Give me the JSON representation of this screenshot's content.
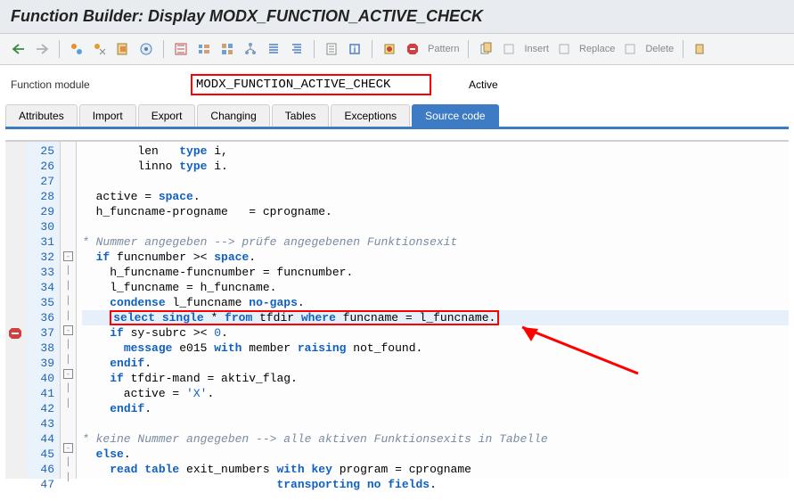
{
  "title": "Function Builder: Display MODX_FUNCTION_ACTIVE_CHECK",
  "toolbar": {
    "pattern": "Pattern",
    "insert": "Insert",
    "replace": "Replace",
    "delete": "Delete"
  },
  "fm": {
    "label": "Function module",
    "value": "MODX_FUNCTION_ACTIVE_CHECK",
    "status": "Active"
  },
  "tabs": {
    "attributes": "Attributes",
    "import": "Import",
    "export": "Export",
    "changing": "Changing",
    "tables": "Tables",
    "exceptions": "Exceptions",
    "source": "Source code"
  },
  "code": {
    "lines": [
      {
        "n": 25,
        "t": "        len   type i,"
      },
      {
        "n": 26,
        "t": "        linno type i."
      },
      {
        "n": 27,
        "t": ""
      },
      {
        "n": 28,
        "t": "  active = space."
      },
      {
        "n": 29,
        "t": "  h_funcname-progname   = cprogname."
      },
      {
        "n": 30,
        "t": ""
      },
      {
        "n": 31,
        "t": "* Nummer angegeben --> prüfe angegebenen Funktionsexit"
      },
      {
        "n": 32,
        "t": "  if funcnumber >< space."
      },
      {
        "n": 33,
        "t": "    h_funcname-funcnumber = funcnumber."
      },
      {
        "n": 34,
        "t": "    l_funcname = h_funcname."
      },
      {
        "n": 35,
        "t": "    condense l_funcname no-gaps."
      },
      {
        "n": 36,
        "t": "    select single * from tfdir where funcname = l_funcname."
      },
      {
        "n": 37,
        "t": "    if sy-subrc >< 0."
      },
      {
        "n": 38,
        "t": "      message e015 with member raising not_found."
      },
      {
        "n": 39,
        "t": "    endif."
      },
      {
        "n": 40,
        "t": "    if tfdir-mand = aktiv_flag."
      },
      {
        "n": 41,
        "t": "      active = 'X'."
      },
      {
        "n": 42,
        "t": "    endif."
      },
      {
        "n": 43,
        "t": ""
      },
      {
        "n": 44,
        "t": "* keine Nummer angegeben --> alle aktiven Funktionsexits in Tabelle"
      },
      {
        "n": 45,
        "t": "  else."
      },
      {
        "n": 46,
        "t": "    read table exit_numbers with key program = cprogname"
      },
      {
        "n": 47,
        "t": "                            transporting no fields."
      }
    ]
  }
}
